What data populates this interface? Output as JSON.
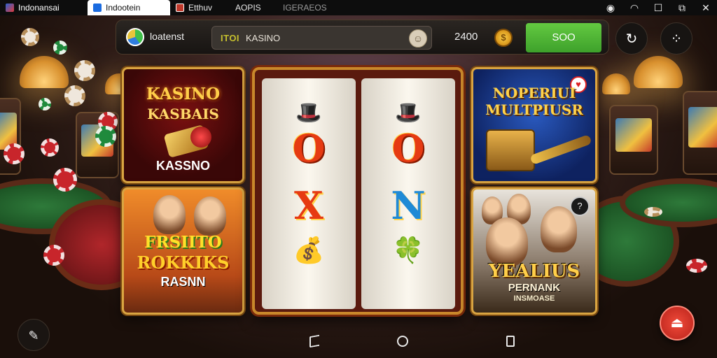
{
  "statusbar": {
    "tabs": [
      {
        "label": "Indonansai"
      },
      {
        "label": "Indootein"
      },
      {
        "label": "Etthuv"
      },
      {
        "label": "AOPIS"
      },
      {
        "label": "IGERAEOS"
      }
    ]
  },
  "appbar": {
    "brand": "loatenst",
    "search_prefix": "ITOI",
    "search_value": "KASINO",
    "coins": "2400",
    "action_label": "SOO"
  },
  "games": {
    "card1": {
      "line1": "KASINO",
      "line2": "KASBAIS",
      "line3": "KASSNO"
    },
    "card2": {
      "line1": "FRSIITO",
      "line2": "ROKKIKS",
      "line3": "RASNN"
    },
    "card3": {
      "line1": "NOPERIUI",
      "line2": "MULTPIUSR"
    },
    "card4": {
      "line1": "YEALIUS",
      "line2": "PERNANK",
      "line3": "INSMOASE"
    }
  },
  "reels": {
    "reel1": [
      "O",
      "X"
    ],
    "reel2": [
      "O",
      "N"
    ]
  },
  "colors": {
    "accent_green": "#4fb535",
    "gold_frame": "#d9a441",
    "fab_red": "#e0362a"
  }
}
